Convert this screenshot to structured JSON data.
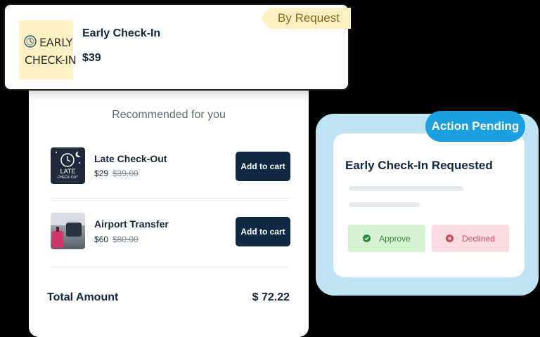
{
  "checkin": {
    "thumb_word_1": "EARLY",
    "thumb_word_2": "CHECK-IN",
    "title": "Early Check-In",
    "price": "$39",
    "tag": "By Request"
  },
  "recommendations": {
    "heading": "Recommended for you",
    "items": [
      {
        "name": "Late Check-Out",
        "price": "$29",
        "old_price": "$39.00",
        "thumb_text": "LATE",
        "thumb_subtext": "CHECK-OUT",
        "button": "Add to cart"
      },
      {
        "name": "Airport Transfer",
        "price": "$60",
        "old_price": "$80.00",
        "button": "Add to cart"
      }
    ],
    "total_label": "Total Amount",
    "total_value": "$ 72.22"
  },
  "action": {
    "status": "Action Pending",
    "title": "Early Check-In Requested",
    "approve": "Approve",
    "decline": "Declined"
  },
  "colors": {
    "navy": "#0f2945",
    "accent_blue": "#1a9fe0",
    "tag_yellow": "#fdf1c3",
    "approve_green": "#d6f1d4",
    "decline_pink": "#fbdde1"
  }
}
